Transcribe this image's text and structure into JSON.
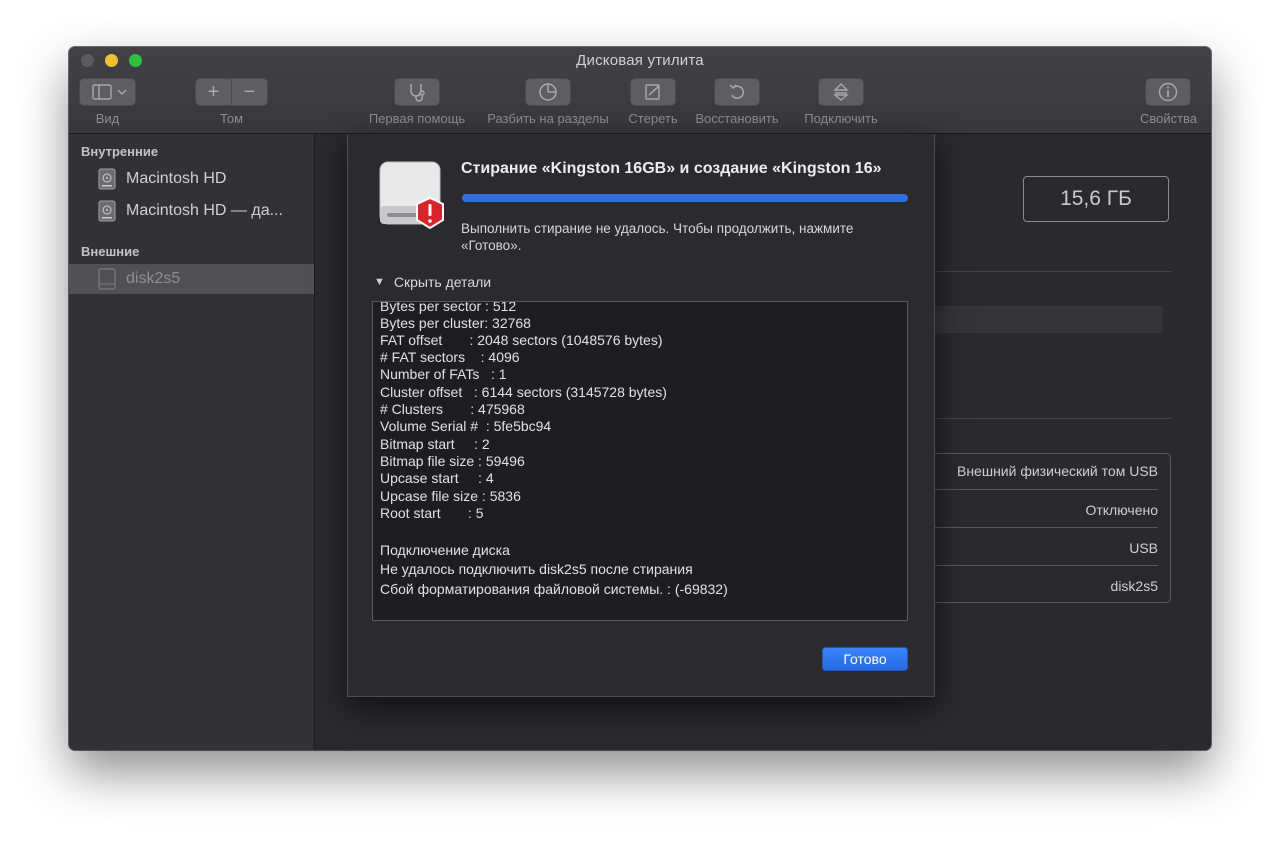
{
  "window": {
    "title": "Дисковая утилита"
  },
  "toolbar": {
    "view_label": "Вид",
    "volume_label": "Том",
    "first_aid_label": "Первая помощь",
    "partition_label": "Разбить на разделы",
    "erase_label": "Стереть",
    "restore_label": "Восстановить",
    "mount_label": "Подключить",
    "info_label": "Свойства",
    "add_symbol": "+",
    "remove_symbol": "−"
  },
  "sidebar": {
    "internal_header": "Внутренние",
    "internal_items": [
      "Macintosh HD",
      "Macintosh HD — да..."
    ],
    "external_header": "Внешние",
    "external_items": [
      "disk2s5"
    ]
  },
  "main": {
    "capacity": "15,6 ГБ",
    "info_rows": [
      "Внешний физический том USB",
      "Отключено",
      "USB",
      "disk2s5"
    ]
  },
  "sheet": {
    "title": "Стирание «Kingston 16GB» и создание «Kingston 16»",
    "progress": 1.0,
    "message": "Выполнить стирание не удалось. Чтобы продолжить, нажмите «Готово».",
    "details_toggle": "Скрыть детали",
    "log_lines": [
      "Bytes per sector : 512",
      "Bytes per cluster: 32768",
      "FAT offset       : 2048 sectors (1048576 bytes)",
      "# FAT sectors    : 4096",
      "Number of FATs   : 1",
      "Cluster offset   : 6144 sectors (3145728 bytes)",
      "# Clusters       : 475968",
      "Volume Serial #  : 5fe5bc94",
      "Bitmap start     : 2",
      "Bitmap file size : 59496",
      "Upcase start     : 4",
      "Upcase file size : 5836",
      "Root start       : 5",
      "Подключение диска",
      "Не удалось подключить disk2s5 после стирания",
      "Сбой форматирования файловой системы. : (-69832)"
    ],
    "done_button": "Готово",
    "accent_color": "#2f6fe0",
    "error_badge_icon": "alert-exclamation-icon"
  }
}
